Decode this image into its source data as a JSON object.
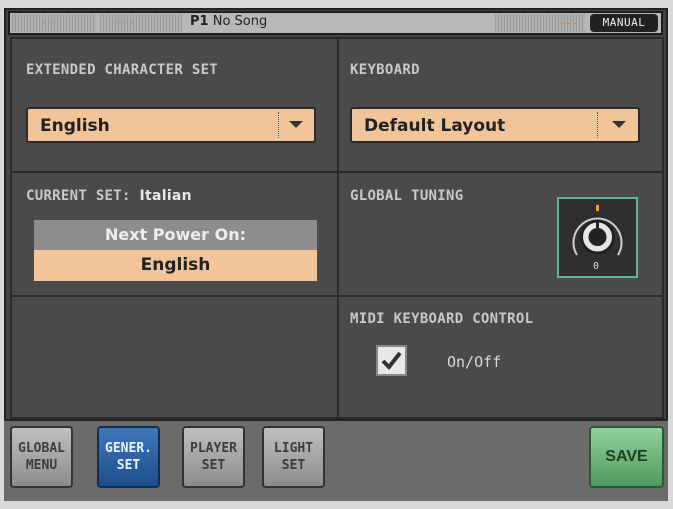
{
  "topbar": {
    "dash1": "--",
    "dash2": "---",
    "program": "P1",
    "song": "No Song",
    "dash3": "---",
    "mode": "MANUAL"
  },
  "extended_character_set": {
    "title": "EXTENDED CHARACTER SET",
    "selected": "English"
  },
  "keyboard": {
    "title": "KEYBOARD",
    "selected": "Default Layout"
  },
  "current_set": {
    "label": "CURRENT SET:",
    "value": "Italian",
    "next_power_label": "Next Power On:",
    "next_power_value": "English"
  },
  "global_tuning": {
    "title": "GLOBAL TUNING",
    "value": "0"
  },
  "midi_keyboard_control": {
    "title": "MIDI KEYBOARD CONTROL",
    "checkbox_label": "On/Off",
    "checked": true
  },
  "tabs": [
    {
      "line1": "GLOBAL",
      "line2": "MENU"
    },
    {
      "line1": "GENER.",
      "line2": "SET"
    },
    {
      "line1": "PLAYER",
      "line2": "SET"
    },
    {
      "line1": "LIGHT",
      "line2": "SET"
    }
  ],
  "save_label": "SAVE",
  "colors": {
    "accent_orange": "#f2c49a",
    "active_tab": "#1c4f8c",
    "save_green": "#4f9a5e",
    "knob_border": "#5fb39a"
  }
}
